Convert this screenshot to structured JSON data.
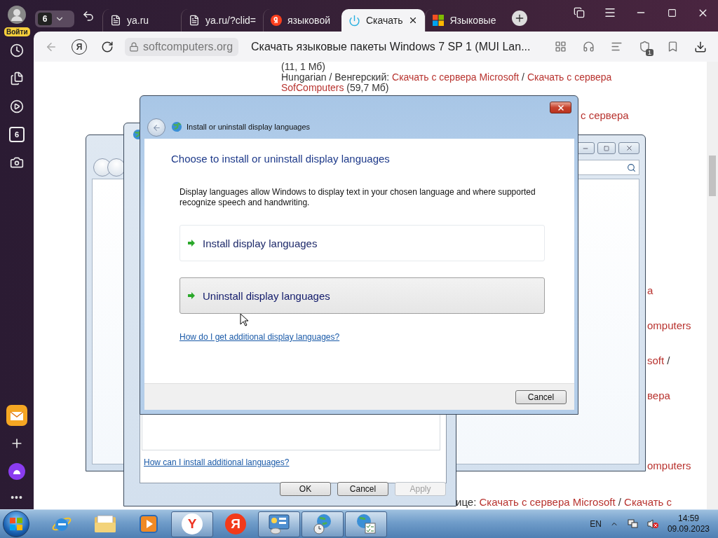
{
  "sidebar": {
    "login": "Войти",
    "counter": "6",
    "more": "•••"
  },
  "tabbar": {
    "tab_count": "6",
    "tabs": [
      {
        "label": "ya.ru",
        "kind": "doc",
        "selected": false
      },
      {
        "label": "ya.ru/?clid=",
        "kind": "doc",
        "selected": false
      },
      {
        "label": "языковой",
        "kind": "yandex",
        "selected": false
      },
      {
        "label": "Скачать",
        "kind": "power",
        "selected": true
      },
      {
        "label": "Языковые",
        "kind": "windows",
        "selected": false
      }
    ]
  },
  "toolbar": {
    "home_button": "Я",
    "domain": "softcomputers.org",
    "page_title": "Скачать языковые пакеты Windows 7 SP 1 (MUI Lan...",
    "shield_badge": "1"
  },
  "page": {
    "top_lines": [
      [
        {
          "kind": "text",
          "text": "(11, 1 Мб)"
        }
      ],
      [
        {
          "kind": "text",
          "text": "Hungarian / Венгерский: "
        },
        {
          "kind": "link",
          "text": "Скачать с сервера Microsoft"
        },
        {
          "kind": "text",
          "text": " / "
        },
        {
          "kind": "link",
          "text": "Скачать с сервера"
        }
      ],
      [
        {
          "kind": "link",
          "text": "SofComputers"
        },
        {
          "kind": "text",
          "text": " (59,7 Мб)"
        }
      ]
    ],
    "right_fragments": [
      [
        {
          "kind": "link",
          "text": "с сервера"
        }
      ],
      [
        {
          "kind": "link",
          "text": "а"
        }
      ],
      [
        {
          "kind": "link",
          "text": "omputers"
        }
      ],
      [
        {
          "kind": "link",
          "text": "soft"
        },
        {
          "kind": "text",
          "text": " /"
        }
      ],
      [
        {
          "kind": "link",
          "text": "вера"
        }
      ],
      [
        {
          "kind": "link",
          "text": "omputers"
        }
      ]
    ],
    "bottom_line": [
      {
        "kind": "text",
        "text": "ице: "
      },
      {
        "kind": "link",
        "text": "Скачать с сервера Microsoft"
      },
      {
        "kind": "text",
        "text": " / "
      },
      {
        "kind": "link",
        "text": "Скачать с"
      }
    ]
  },
  "language_window": {
    "help_link": "How can I install additional languages?",
    "buttons": [
      {
        "label": "OK",
        "disabled": false
      },
      {
        "label": "Cancel",
        "disabled": false
      },
      {
        "label": "Apply",
        "disabled": true
      }
    ]
  },
  "display_dialog": {
    "title": "Install or uninstall display languages",
    "heading": "Choose to install or uninstall display languages",
    "description": "Display languages allow Windows to display text in your chosen language and where supported recognize speech and handwriting.",
    "options": [
      {
        "label": "Install display languages",
        "hovered": false
      },
      {
        "label": "Uninstall display languages",
        "hovered": true
      }
    ],
    "help_link": "How do I get additional display languages?",
    "cancel": "Cancel"
  },
  "taskbar": {
    "items": [
      {
        "kind": "ie",
        "active": false
      },
      {
        "kind": "folder",
        "active": false
      },
      {
        "kind": "media",
        "active": false
      },
      {
        "kind": "browser",
        "label": "Y",
        "active": true
      },
      {
        "kind": "yandex",
        "label": "Я",
        "active": false
      },
      {
        "kind": "control",
        "active": true
      },
      {
        "kind": "clock",
        "active": true
      },
      {
        "kind": "checklist",
        "active": true
      }
    ],
    "language": "EN",
    "time": "14:59",
    "date": "09.09.2023"
  }
}
